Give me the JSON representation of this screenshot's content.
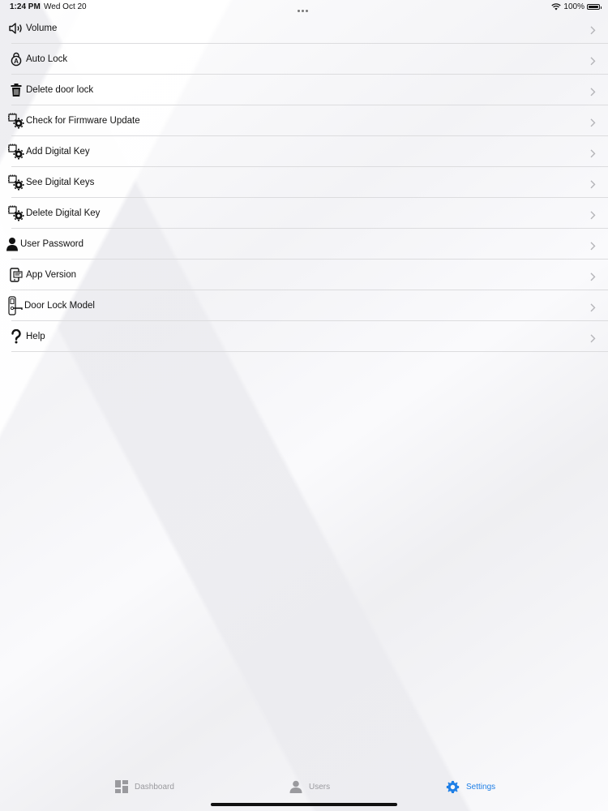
{
  "status": {
    "time": "1:24 PM",
    "date": "Wed Oct 20",
    "battery": "100%"
  },
  "settings": {
    "items": [
      {
        "label": "Volume",
        "icon": "speaker-icon"
      },
      {
        "label": "Auto Lock",
        "icon": "auto-lock-icon"
      },
      {
        "label": "Delete door lock",
        "icon": "trash-icon"
      },
      {
        "label": "Check for Firmware Update",
        "icon": "gear-chip-icon"
      },
      {
        "label": "Add Digital Key",
        "icon": "gear-chip-icon"
      },
      {
        "label": "See Digital Keys",
        "icon": "gear-chip-icon"
      },
      {
        "label": "Delete Digital Key",
        "icon": "gear-chip-icon"
      },
      {
        "label": "User Password",
        "icon": "user-icon"
      },
      {
        "label": "App Version",
        "icon": "device-icon"
      },
      {
        "label": "Door Lock Model",
        "icon": "door-lock-icon"
      },
      {
        "label": "Help",
        "icon": "question-icon"
      }
    ]
  },
  "tabbar": {
    "dashboard": "Dashboard",
    "users": "Users",
    "settings": "Settings",
    "active": "settings",
    "accent": "#1f7fe6",
    "inactive": "#9a9a9e"
  }
}
